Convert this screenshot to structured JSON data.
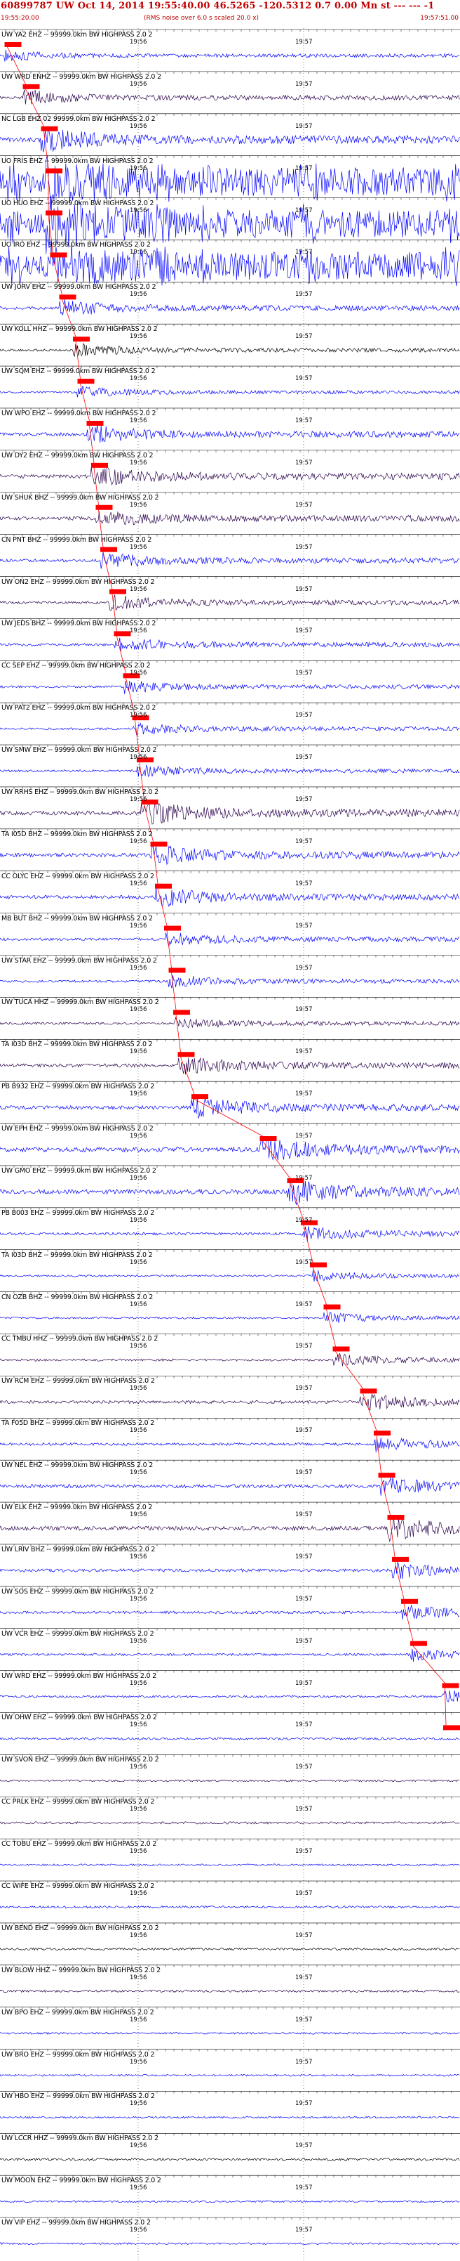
{
  "header": {
    "title": "60899787 UW Oct 14, 2014 19:55:40.00   46.5265 -120.5312  0.7 0.00 Mn st --- --- -1",
    "start_time": "19:55:20.00",
    "rms_note": "(RMS noise over 6.0 s scaled 20.0 x)",
    "end_time": "19:57:51.00"
  },
  "time_marks": [
    "19:56",
    "19:57"
  ],
  "colors": {
    "blue": "#0000ff",
    "dark": "#28004a",
    "black": "#000000",
    "pick": "#ff0000",
    "title": "#c00000"
  },
  "traces": [
    {
      "label": "UW YA2 EHZ -- 99999.0km BW  HIGHPASS  2.0  2",
      "color": "blue",
      "amp": 0.25,
      "pick": 0.01
    },
    {
      "label": "UW WRD ENHZ -- 99999.0km BW  HIGHPASS  2.0  2",
      "color": "dark",
      "amp": 0.35,
      "pick": 0.05
    },
    {
      "label": "NC LGB EHZ 02 99999.0km BW  HIGHPASS  2.0  2",
      "color": "blue",
      "amp": 0.6,
      "pick": 0.09
    },
    {
      "label": "UO FRIS EHZ -- 99999.0km BW  HIGHPASS  2.0  2",
      "color": "blue",
      "amp": 0.95,
      "pick": 0.1
    },
    {
      "label": "UO HUO EHZ -- 99999.0km BW  HIGHPASS  2.0  2",
      "color": "blue",
      "amp": 0.95,
      "pick": 0.1
    },
    {
      "label": "UO IRO EHZ -- 99999.0km BW  HIGHPASS  2.0  2",
      "color": "blue",
      "amp": 0.95,
      "pick": 0.11
    },
    {
      "label": "UW JORV EHZ -- 99999.0km BW  HIGHPASS  2.0  2",
      "color": "blue",
      "amp": 0.4,
      "pick": 0.13
    },
    {
      "label": "UW KOLL HHZ -- 99999.0km BW  HIGHPASS  2.0  2",
      "color": "black",
      "amp": 0.3,
      "pick": 0.16
    },
    {
      "label": "UW SQM EHZ -- 99999.0km BW  HIGHPASS  2.0  2",
      "color": "blue",
      "amp": 0.25,
      "pick": 0.17
    },
    {
      "label": "UW WPO EHZ -- 99999.0km BW  HIGHPASS  2.0  2",
      "color": "blue",
      "amp": 0.45,
      "pick": 0.19
    },
    {
      "label": "UW DY2 EHZ -- 99999.0km BW  HIGHPASS  2.0  2",
      "color": "dark",
      "amp": 0.5,
      "pick": 0.2
    },
    {
      "label": "UW SHUK BHZ -- 99999.0km BW  HIGHPASS  2.0  2",
      "color": "dark",
      "amp": 0.45,
      "pick": 0.21
    },
    {
      "label": "CN PNT BHZ -- 99999.0km BW  HIGHPASS  2.0  2",
      "color": "blue",
      "amp": 0.4,
      "pick": 0.22
    },
    {
      "label": "UW ON2 EHZ -- 99999.0km BW  HIGHPASS  2.0  2",
      "color": "dark",
      "amp": 0.35,
      "pick": 0.24
    },
    {
      "label": "UW JEDS BHZ -- 99999.0km BW  HIGHPASS  2.0  2",
      "color": "blue",
      "amp": 0.35,
      "pick": 0.25
    },
    {
      "label": "CC SEP EHZ -- 99999.0km BW  HIGHPASS  2.0  2",
      "color": "blue",
      "amp": 0.3,
      "pick": 0.27
    },
    {
      "label": "UW PAT2 EHZ -- 99999.0km BW  HIGHPASS  2.0  2",
      "color": "blue",
      "amp": 0.3,
      "pick": 0.29
    },
    {
      "label": "UW SMW EHZ -- 99999.0km BW  HIGHPASS  2.0  2",
      "color": "blue",
      "amp": 0.3,
      "pick": 0.3
    },
    {
      "label": "UW RRHS EHZ -- 99999.0km BW  HIGHPASS  2.0  2",
      "color": "dark",
      "amp": 0.55,
      "pick": 0.31
    },
    {
      "label": "TA I05D BHZ -- 99999.0km BW  HIGHPASS  2.0  2",
      "color": "blue",
      "amp": 0.5,
      "pick": 0.33
    },
    {
      "label": "CC OLYC EHZ -- 99999.0km BW  HIGHPASS  2.0  2",
      "color": "blue",
      "amp": 0.45,
      "pick": 0.34
    },
    {
      "label": "MB BUT BHZ -- 99999.0km BW  HIGHPASS  2.0  2",
      "color": "blue",
      "amp": 0.35,
      "pick": 0.36
    },
    {
      "label": "UW STAR EHZ -- 99999.0km BW  HIGHPASS  2.0  2",
      "color": "blue",
      "amp": 0.3,
      "pick": 0.37
    },
    {
      "label": "UW TUCA HHZ -- 99999.0km BW  HIGHPASS  2.0  2",
      "color": "dark",
      "amp": 0.3,
      "pick": 0.38
    },
    {
      "label": "TA I03D BHZ -- 99999.0km BW  HIGHPASS  2.0  2",
      "color": "dark",
      "amp": 0.45,
      "pick": 0.39
    },
    {
      "label": "PB B932 EHZ -- 99999.0km BW  HIGHPASS  2.0  2",
      "color": "blue",
      "amp": 0.5,
      "pick": 0.42
    },
    {
      "label": "UW EPH EHZ -- 99999.0km BW  HIGHPASS  2.0  2",
      "color": "blue",
      "amp": 0.6,
      "pick": 0.57
    },
    {
      "label": "UW GMO EHZ -- 99999.0km BW  HIGHPASS  2.0  2",
      "color": "blue",
      "amp": 0.6,
      "pick": 0.63
    },
    {
      "label": "PB B003 EHZ -- 99999.0km BW  HIGHPASS  2.0  2",
      "color": "blue",
      "amp": 0.35,
      "pick": 0.66
    },
    {
      "label": "TA I03D BHZ -- 99999.0km BW  HIGHPASS  2.0  2",
      "color": "blue",
      "amp": 0.25,
      "pick": 0.68
    },
    {
      "label": "CN OZB BHZ -- 99999.0km BW  HIGHPASS  2.0  2",
      "color": "blue",
      "amp": 0.25,
      "pick": 0.71
    },
    {
      "label": "CC TMBU HHZ -- 99999.0km BW  HIGHPASS  2.0  2",
      "color": "dark",
      "amp": 0.3,
      "pick": 0.73
    },
    {
      "label": "UW RCM EHZ -- 99999.0km BW  HIGHPASS  2.0  2",
      "color": "dark",
      "amp": 0.4,
      "pick": 0.79
    },
    {
      "label": "TA F05D BHZ -- 99999.0km BW  HIGHPASS  2.0  2",
      "color": "blue",
      "amp": 0.35,
      "pick": 0.82
    },
    {
      "label": "UW NEL EHZ -- 99999.0km BW  HIGHPASS  2.0  2",
      "color": "blue",
      "amp": 0.45,
      "pick": 0.83
    },
    {
      "label": "UW ELK EHZ -- 99999.0km BW  HIGHPASS  2.0  2",
      "color": "dark",
      "amp": 0.55,
      "pick": 0.85
    },
    {
      "label": "UW LRIV BHZ -- 99999.0km BW  HIGHPASS  2.0  2",
      "color": "blue",
      "amp": 0.4,
      "pick": 0.86
    },
    {
      "label": "UW SOS EHZ -- 99999.0km BW  HIGHPASS  2.0  2",
      "color": "blue",
      "amp": 0.35,
      "pick": 0.88
    },
    {
      "label": "UW VCR EHZ -- 99999.0km BW  HIGHPASS  2.0  2",
      "color": "blue",
      "amp": 0.3,
      "pick": 0.9
    },
    {
      "label": "UW WRD EHZ -- 99999.0km BW  HIGHPASS  2.0  2",
      "color": "blue",
      "amp": 0.3,
      "pick": 0.97
    },
    {
      "label": "UW OHW EHZ -- 99999.0km BW  HIGHPASS  2.0  2",
      "color": "blue",
      "amp": 0.3,
      "pick": 1.02
    },
    {
      "label": "UW SVON EHZ -- 99999.0km BW  HIGHPASS  2.0  2",
      "color": "dark",
      "amp": 0.25,
      "pick": null
    },
    {
      "label": "CC PRLK EHZ -- 99999.0km BW  HIGHPASS  2.0  2",
      "color": "dark",
      "amp": 0.3,
      "pick": null
    },
    {
      "label": "CC TOBU EHZ -- 99999.0km BW  HIGHPASS  2.0  2",
      "color": "blue",
      "amp": 0.25,
      "pick": null
    },
    {
      "label": "CC WIFE EHZ -- 99999.0km BW  HIGHPASS  2.0  2",
      "color": "blue",
      "amp": 0.3,
      "pick": null
    },
    {
      "label": "UW BEND EHZ -- 99999.0km BW  HIGHPASS  2.0  2",
      "color": "black",
      "amp": 0.3,
      "pick": null
    },
    {
      "label": "UW BLOW HHZ -- 99999.0km BW  HIGHPASS  2.0  2",
      "color": "dark",
      "amp": 0.3,
      "pick": null
    },
    {
      "label": "UW BPO EHZ -- 99999.0km BW  HIGHPASS  2.0  2",
      "color": "blue",
      "amp": 0.25,
      "pick": null
    },
    {
      "label": "UW BRO EHZ -- 99999.0km BW  HIGHPASS  2.0  2",
      "color": "blue",
      "amp": 0.25,
      "pick": null
    },
    {
      "label": "UW HBO EHZ -- 99999.0km BW  HIGHPASS  2.0  2",
      "color": "blue",
      "amp": 0.25,
      "pick": null
    },
    {
      "label": "UW LCCR HHZ -- 99999.0km BW  HIGHPASS  2.0  2",
      "color": "black",
      "amp": 0.3,
      "pick": null
    },
    {
      "label": "UW MOON EHZ -- 99999.0km BW  HIGHPASS  2.0  2",
      "color": "blue",
      "amp": 0.25,
      "pick": null
    },
    {
      "label": "UW VIP EHZ -- 99999.0km BW  HIGHPASS  2.0  2",
      "color": "blue",
      "amp": 0.25,
      "pick": null
    }
  ]
}
